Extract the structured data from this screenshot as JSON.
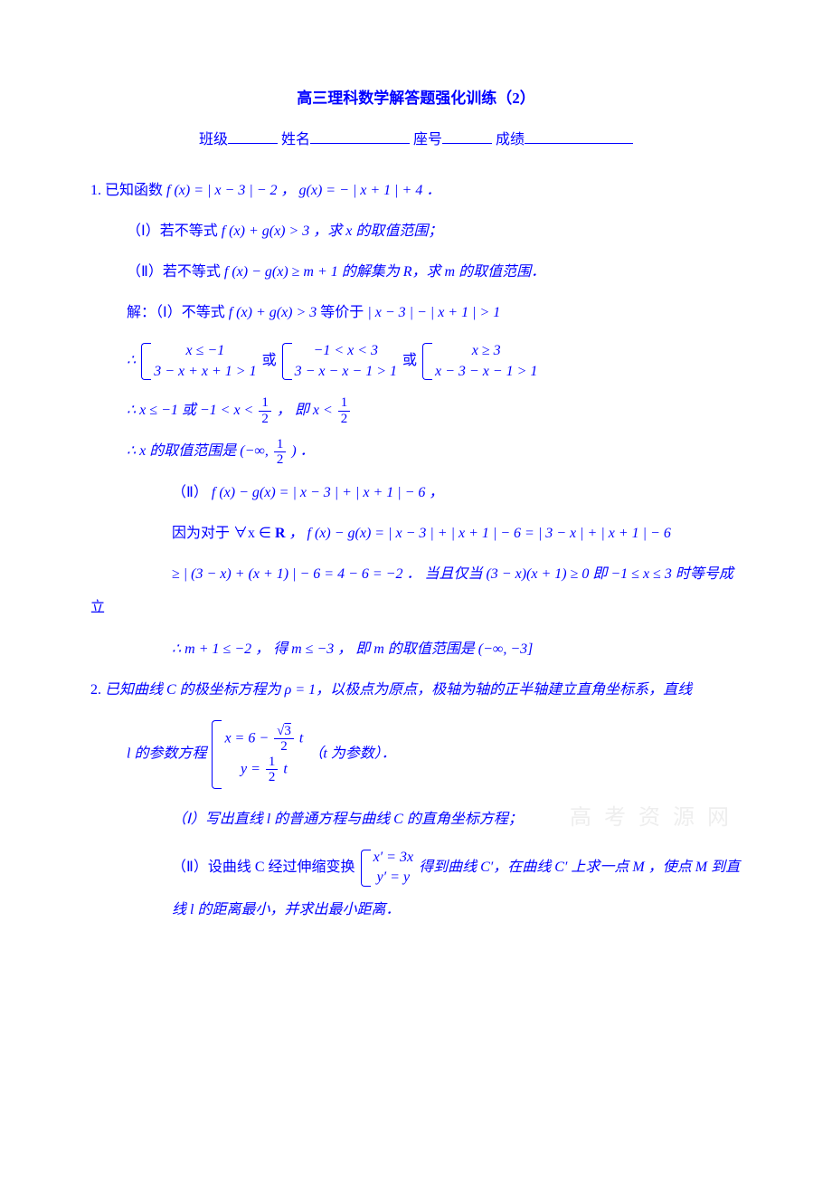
{
  "title": "高三理科数学解答题强化训练（2）",
  "header": {
    "class_label": "班级",
    "name_label": "姓名",
    "seat_label": "座号",
    "score_label": "成绩"
  },
  "p1": {
    "num": "1.",
    "stem_a": "已知函数 ",
    "stem_math": "f (x) = | x − 3 | − 2 ，  g(x) = − | x + 1 | + 4 ．",
    "part1_a": "（Ⅰ）若不等式 ",
    "part1_math": "f (x) + g(x) > 3",
    "part1_b": " ，求 x 的取值范围；",
    "part2_a": "（Ⅱ）若不等式 ",
    "part2_math": "f (x) − g(x) ≥ m + 1",
    "part2_b": " 的解集为 R，求 m 的取值范围．",
    "sol_label_a": "解：（Ⅰ）不等式 ",
    "sol_eq1": "f (x) + g(x) > 3",
    "sol_label_b": " 等价于 ",
    "sol_eq2": "| x − 3 | − | x + 1 | > 1",
    "therefore1": "∴",
    "case1_a": "x ≤ −1",
    "case1_b": "3 − x + x + 1 > 1",
    "or": "或",
    "case2_a": "−1 < x < 3",
    "case2_b": "3 − x − x − 1 > 1",
    "case3_a": "x ≥ 3",
    "case3_b": "x − 3 − x − 1 > 1",
    "line3_a": "∴ x ≤ −1 或 −1 < x < ",
    "half_num": "1",
    "half_den": "2",
    "line3_b": "， 即 x < ",
    "line4_a": "∴ x 的取值范围是 (−∞, ",
    "line4_b": ") ．",
    "part2_sol_a": "（Ⅱ） ",
    "part2_sol_eq": "f (x) − g(x) = | x − 3 | + | x + 1 | − 6 ，",
    "line5_a": "因为对于 ∀x ∈ ",
    "bold_R": "R",
    "line5_b": " ，   f (x) − g(x) = | x − 3 | + | x + 1 | − 6 = | 3 − x | + | x + 1 | − 6",
    "line6": "≥ | (3 − x) + (x + 1) | − 6 = 4 − 6 = −2 ．  当且仅当 (3 − x)(x + 1) ≥ 0 即 −1 ≤ x ≤ 3 时等号成",
    "line6b": "立",
    "line7": "∴ m + 1 ≤ −2 ， 得 m ≤ −3 ， 即 m 的取值范围是 (−∞, −3]"
  },
  "p2": {
    "num": "2.",
    "stem_a": "已知曲线 C 的极坐标方程为 ρ = 1，以极点为原点，极轴为轴的正半轴建立直角坐标系，直线",
    "param_a": "l 的参数方程",
    "eq1_prefix": "x = 6 − ",
    "eq1_num": "3",
    "eq1_den": "2",
    "eq1_suffix": " t",
    "eq2_prefix": "y = ",
    "eq2_num": "1",
    "eq2_den2": "2",
    "eq2_suffix": " t",
    "param_b": "（t 为参数）．",
    "part1": "（Ⅰ）写出直线 l 的普通方程与曲线 C 的直角坐标方程；",
    "part2_a": "（Ⅱ）设曲线 C 经过伸缩变换 ",
    "sc1": "x′ = 3x",
    "sc2": "y′ = y",
    "part2_b": " 得到曲线 C′，在曲线 C′ 上求一点 M ，使点 M 到直",
    "part2_c": "线 l 的距离最小，并求出最小距离．"
  },
  "watermark": "高 考 资 源 网"
}
